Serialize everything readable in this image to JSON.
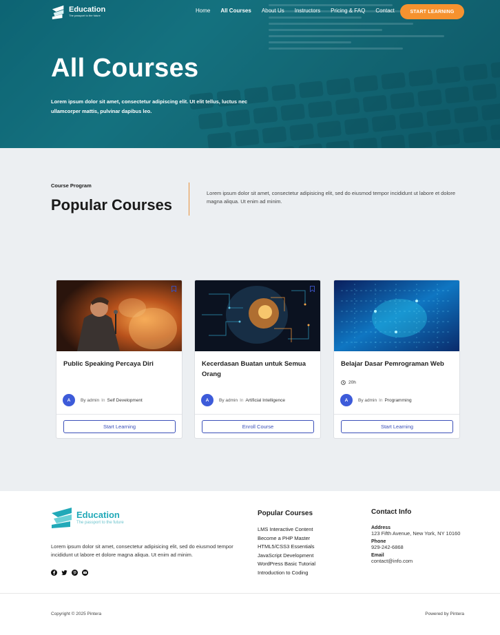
{
  "header": {
    "logo_name": "Education",
    "logo_tagline": "The passport to the future",
    "nav": [
      "Home",
      "All Courses",
      "About Us",
      "Instructors",
      "Pricing & FAQ",
      "Contact"
    ],
    "active_nav": "All Courses",
    "cta": "START LEARNING"
  },
  "hero": {
    "title": "All Courses",
    "subtitle": "Lorem ipsum dolor sit amet, consectetur adipiscing elit. Ut elit tellus, luctus nec ullamcorper mattis, pulvinar dapibus leo."
  },
  "section": {
    "eyebrow": "Course Program",
    "title": "Popular Courses",
    "description": "Lorem ipsum dolor sit amet, consectetur adipisicing elit, sed do eiusmod tempor incididunt ut labore et dolore magna aliqua. Ut enim ad minim."
  },
  "courses": [
    {
      "title": "Public Speaking Percaya Diri",
      "duration": "",
      "avatar": "A",
      "author_prefix": "By",
      "author": "admin",
      "in": "In",
      "category": "Self Development",
      "button": "Start Learning"
    },
    {
      "title": "Kecerdasan Buatan untuk Semua Orang",
      "duration": "",
      "avatar": "A",
      "author_prefix": "By",
      "author": "admin",
      "in": "In",
      "category": "Artificial Intelligence",
      "button": "Enroll Course"
    },
    {
      "title": "Belajar Dasar Pemrograman Web",
      "duration": "20h",
      "avatar": "A",
      "author_prefix": "By",
      "author": "admin",
      "in": "In",
      "category": "Programming",
      "button": "Start Learning"
    }
  ],
  "footer": {
    "logo_name": "Education",
    "logo_tagline": "The passport to the future",
    "description": "Lorem ipsum dolor sit amet, consectetur adipisicing elit, sed do eiusmod tempor incididunt ut labore et dolore magna aliqua. Ut enim ad minim.",
    "social_icons": [
      "facebook-icon",
      "twitter-icon",
      "pinterest-icon",
      "youtube-icon"
    ],
    "popular_heading": "Popular Courses",
    "popular_links": [
      "LMS Interactive Content",
      "Become a PHP Master",
      "HTML5/CSS3 Essentials",
      "JavaScript Development",
      "WordPress Basic Tutorial",
      "Introduction to Coding"
    ],
    "contact_heading": "Contact Info",
    "address_label": "Address",
    "address": "123 Fifth Avenue, New York, NY 10160",
    "phone_label": "Phone",
    "phone": "929-242-6868",
    "email_label": "Email",
    "email": "contact@info.com",
    "copyright": "Copyright © 2025 Pintera",
    "powered": "Powered by Pintera"
  },
  "colors": {
    "hero_teal": "#1a7f8c",
    "accent_orange": "#f6922f",
    "primary_blue": "#3a4fb8",
    "section_bg": "#eceff2"
  }
}
